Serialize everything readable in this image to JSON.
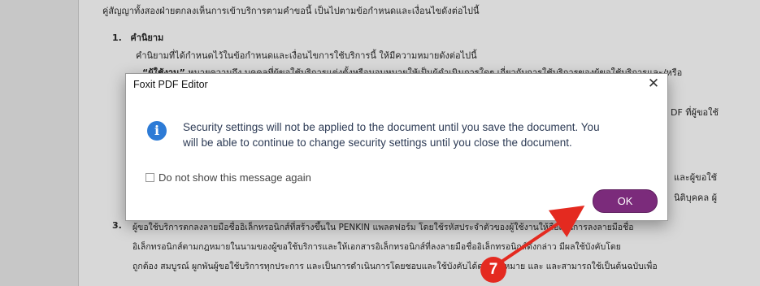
{
  "document": {
    "line_top": "คู่สัญญาทั้งสองฝ่ายตกลงเห็นการเข้าบริการตามคำขอนี้ เป็นไปตามข้อกำหนดและเงื่อนไขดังต่อไปนี้",
    "section1_number": "1.",
    "section1_title": "คำนิยาม",
    "section1_intro": "คำนิยามที่ได้กำหนดไว้ในข้อกำหนดและเงื่อนไขการใช้บริการนี้ ให้มีความหมายดังต่อไปนี้",
    "def_user_term": "“ผู้ใช้งาน”",
    "def_user_text": " หมายความถึง บุคคลที่ผู้ขอใช้บริการแต่งตั้งหรือมอบหมายให้เป็นผู้ดำเนินการใดๆ เกี่ยวกับการใช้บริการของผู้ขอใช้บริการและ/หรือ",
    "right_frag_1": "DF ที่ผู้ขอใช้",
    "right_frag_2": "และผู้ขอใช้",
    "right_frag_3": "นิติบุคคล ผู้",
    "section3_number": "3.",
    "section3_line1": "ผู้ขอใช้บริการตกลงลายมือชื่ออิเล็กทรอนิกส์ที่สร้างขึ้นใน PENKIN แพลตฟอร์ม โดยใช้รหัสประจำตัวของผู้ใช้งานให้ถือเป็นการลงลายมือชื่อ",
    "section3_line2": "อิเล็กทรอนิกส์ตามกฎหมายในนามของผู้ขอใช้บริการและให้เอกสารอิเล็กทรอนิกส์ที่ลงลายมือชื่ออิเล็กทรอนิกส์ดังกล่าว มีผลใช้บังคับโดย",
    "section3_line3": "ถูกต้อง สมบูรณ์ ผูกพันผู้ขอใช้บริการทุกประการ และเป็นการดำเนินการโดยชอบและใช้บังคับได้ตามกฎหมาย และ และสามารถใช้เป็นต้นฉบับเพื่อ"
  },
  "dialog": {
    "title": "Foxit PDF Editor",
    "close_glyph": "✕",
    "info_glyph": "i",
    "message_line1": "Security settings will not be applied to the document until you save the document. You",
    "message_line2": "will be able to continue to change security settings until you close the document.",
    "checkbox_label": "Do not show this message again",
    "checkbox_checked": false,
    "ok_label": "OK",
    "ok_color": "#7b2b7b"
  },
  "annotation": {
    "step_number": "7",
    "color": "#e42a20"
  }
}
